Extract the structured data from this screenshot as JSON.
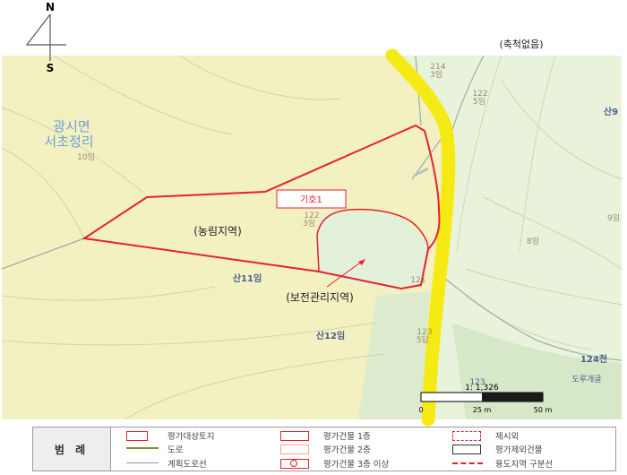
{
  "compass": {
    "north": "N",
    "south": "S"
  },
  "header_note": "(축척없음)",
  "map_labels": {
    "place_line1": "광시면",
    "place_line2": "서초정리",
    "zone_farm": "(농림지역)",
    "zone_conserve": "(보전관리지역)",
    "tag_box": "기호1",
    "parcel_10": "10임",
    "parcel_122_top_a": "122",
    "parcel_122_top_b": "5임",
    "parcel_214_a": "214",
    "parcel_214_b": "3임",
    "parcel_san9": "산9",
    "parcel_122_main_a": "122",
    "parcel_122_main_b": "3임",
    "parcel_9": "9임",
    "parcel_8": "8임",
    "parcel_san11": "산11임",
    "parcel_san12": "산12임",
    "parcel_121": "121",
    "parcel_123_a": "123",
    "parcel_123_b": "5답",
    "parcel_123_c": "123",
    "parcel_124": "124천",
    "parcel_dorugae": "도루개골"
  },
  "scale_bar": {
    "ratio": "1: 1,326",
    "tick_0": "0",
    "tick_25": "25 m",
    "tick_50": "50 m"
  },
  "legend": {
    "title": "범 례",
    "items": {
      "target_land": "평가대상토지",
      "road": "도로",
      "planned_road": "계획도로선",
      "bldg_1f": "평가건물 1층",
      "bldg_2f": "평가건물 2층",
      "bldg_3f": "평가건물 3층 이상",
      "excluded": "제시외",
      "excluded_bldg": "평가제외건물",
      "zone_boundary": "용도지역 구분선"
    }
  },
  "colors": {
    "boundary_red": "#e8202a",
    "road_yellow": "#f5ea14",
    "farm_fill": "#f3f1c2",
    "conserve_fill": "#e4f1da",
    "river_blue": "#5b87c7",
    "legend_road_green": "#7a8f2a"
  }
}
